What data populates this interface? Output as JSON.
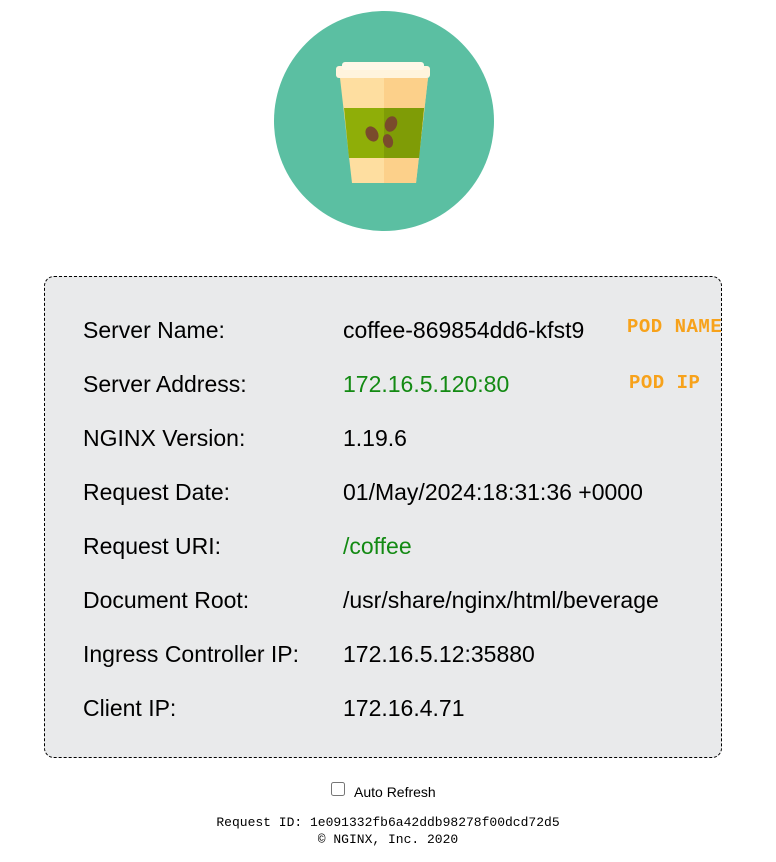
{
  "colors": {
    "logo_circle": "#5bbfa2",
    "info_box_bg": "#e9eaeb",
    "green_value": "#138a13",
    "annotation": "#f7a21b",
    "cup_body": "#fedea0",
    "cup_sleeve": "#8fae08",
    "bean": "#7a4b2c"
  },
  "logo": {
    "icon": "coffee-cup-icon"
  },
  "info": {
    "server_name": {
      "label": "Server Name:",
      "value": "coffee-869854dd6-kfst9"
    },
    "server_address": {
      "label": "Server Address:",
      "value": "172.16.5.120:80"
    },
    "nginx_version": {
      "label": "NGINX Version:",
      "value": "1.19.6"
    },
    "request_date": {
      "label": "Request Date:",
      "value": "01/May/2024:18:31:36 +0000"
    },
    "request_uri": {
      "label": "Request URI:",
      "value": "/coffee"
    },
    "document_root": {
      "label": "Document Root:",
      "value": "/usr/share/nginx/html/beverage"
    },
    "ingress_ip": {
      "label": "Ingress Controller IP:",
      "value": "172.16.5.12:35880"
    },
    "client_ip": {
      "label": "Client IP:",
      "value": "172.16.4.71"
    }
  },
  "annotations": {
    "pod_name": "POD NAME",
    "pod_ip": "POD IP"
  },
  "auto_refresh": {
    "label": "Auto Refresh",
    "checked": false
  },
  "footer": {
    "request_id": "Request ID: 1e091332fb6a42ddb98278f00dcd72d5",
    "copyright": "© NGINX, Inc. 2020"
  }
}
